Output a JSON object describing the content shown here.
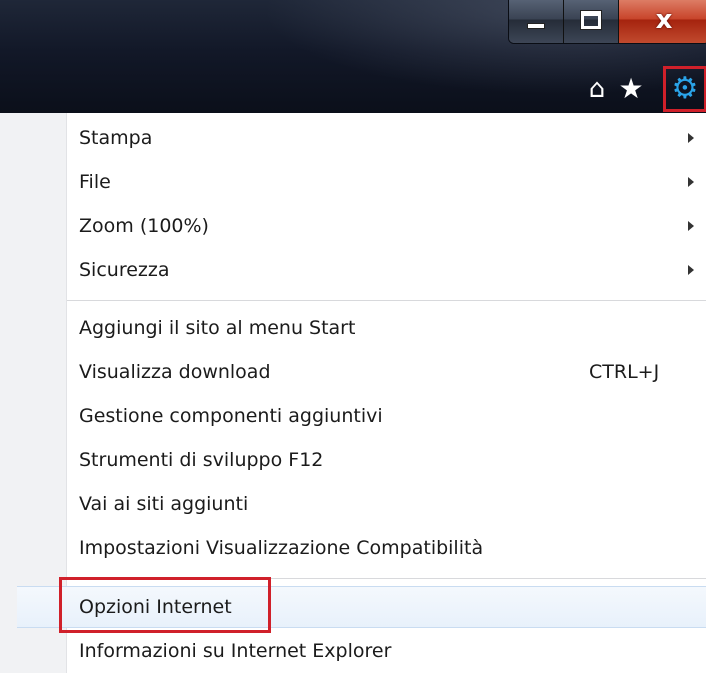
{
  "window": {
    "caption": {
      "minimize_icon": "minimize-icon",
      "maximize_icon": "restore-icon",
      "close_glyph": "x"
    }
  },
  "toolbar": {
    "home_icon": "home-icon",
    "favorites_icon": "star-icon",
    "tools_icon": "gear-icon",
    "tools_highlight_color": "#d0202a",
    "tools_icon_color": "#2aa3e8"
  },
  "menu": {
    "groups": [
      {
        "items": [
          {
            "label": "Stampa",
            "submenu": true
          },
          {
            "label": "File",
            "submenu": true
          },
          {
            "label": "Zoom (100%)",
            "submenu": true
          },
          {
            "label": "Sicurezza",
            "submenu": true
          }
        ]
      },
      {
        "items": [
          {
            "label": "Aggiungi il sito al menu Start"
          },
          {
            "label": "Visualizza download",
            "shortcut": "CTRL+J"
          },
          {
            "label": "Gestione componenti aggiuntivi"
          },
          {
            "label": "Strumenti di sviluppo F12"
          },
          {
            "label": "Vai ai siti aggiunti"
          },
          {
            "label": "Impostazioni Visualizzazione Compatibilità"
          }
        ]
      },
      {
        "items": [
          {
            "label": "Opzioni Internet",
            "highlighted": true
          },
          {
            "label": "Informazioni su Internet Explorer"
          }
        ]
      }
    ]
  }
}
